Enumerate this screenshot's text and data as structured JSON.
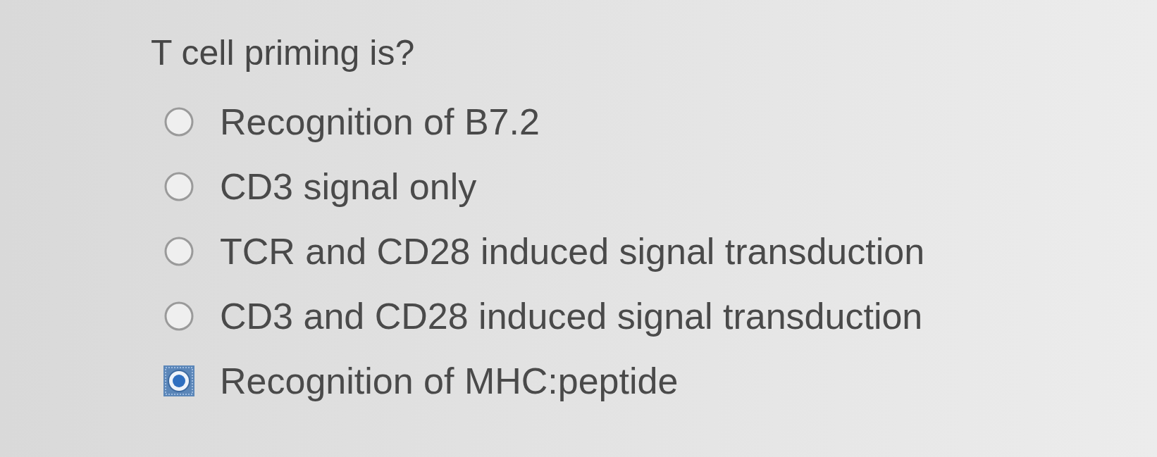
{
  "question": {
    "text": "T cell priming is?"
  },
  "options": [
    {
      "label": "Recognition of B7.2",
      "selected": false
    },
    {
      "label": "CD3 signal only",
      "selected": false
    },
    {
      "label": "TCR and CD28 induced signal transduction",
      "selected": false
    },
    {
      "label": "CD3 and CD28 induced signal transduction",
      "selected": false
    },
    {
      "label": "Recognition of MHC:peptide",
      "selected": true
    }
  ]
}
